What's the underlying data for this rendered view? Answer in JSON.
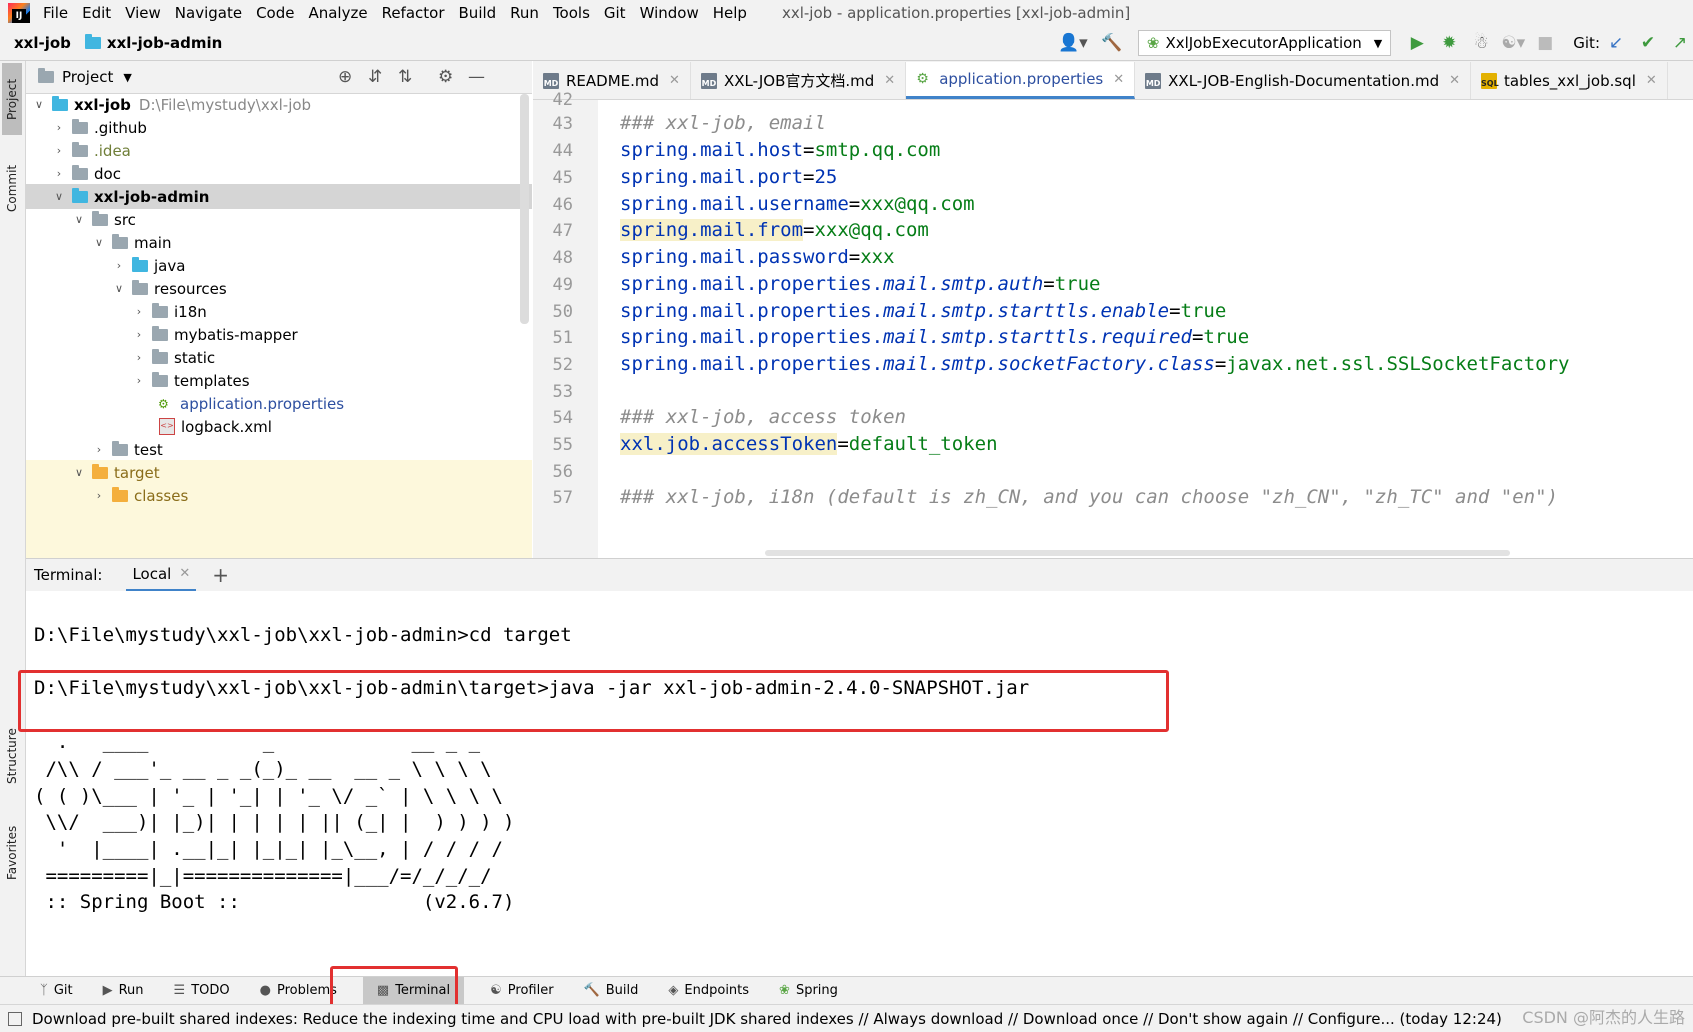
{
  "menubar": {
    "items": [
      "File",
      "Edit",
      "View",
      "Navigate",
      "Code",
      "Analyze",
      "Refactor",
      "Build",
      "Run",
      "Tools",
      "Git",
      "Window",
      "Help"
    ],
    "window_title": "xxl-job - application.properties [xxl-job-admin]"
  },
  "navbar": {
    "crumb_root": "xxl-job",
    "crumb_module": "xxl-job-admin",
    "run_config": "XxlJobExecutorApplication",
    "git_label": "Git:"
  },
  "left_stripe": {
    "project": "Project",
    "commit": "Commit",
    "structure": "Structure",
    "favorites": "Favorites"
  },
  "project_panel": {
    "title": "Project",
    "tree": [
      {
        "label": "xxl-job",
        "hint": "D:\\File\\mystudy\\xxl-job"
      },
      {
        "label": ".github"
      },
      {
        "label": ".idea"
      },
      {
        "label": "doc"
      },
      {
        "label": "xxl-job-admin"
      },
      {
        "label": "src"
      },
      {
        "label": "main"
      },
      {
        "label": "java"
      },
      {
        "label": "resources"
      },
      {
        "label": "i18n"
      },
      {
        "label": "mybatis-mapper"
      },
      {
        "label": "static"
      },
      {
        "label": "templates"
      },
      {
        "label": "application.properties"
      },
      {
        "label": "logback.xml"
      },
      {
        "label": "test"
      },
      {
        "label": "target"
      },
      {
        "label": "classes"
      }
    ]
  },
  "editor": {
    "tabs": [
      "README.md",
      "XXL-JOB官方文档.md",
      "application.properties",
      "XXL-JOB-English-Documentation.md",
      "tables_xxl_job.sql"
    ],
    "line_numbers": [
      "42",
      "43",
      "44",
      "45",
      "46",
      "47",
      "48",
      "49",
      "50",
      "51",
      "52",
      "53",
      "54",
      "55",
      "56",
      "57"
    ],
    "lines": {
      "l43": "### xxl-job, email",
      "l44k": "spring.mail.host",
      "l44v": "smtp.qq.com",
      "l45k": "spring.mail.port",
      "l45v": "25",
      "l46k": "spring.mail.username",
      "l46v": "xxx@qq.com",
      "l47k": "spring.mail.from",
      "l47v": "xxx@qq.com",
      "l48k": "spring.mail.password",
      "l48v": "xxx",
      "l49k": "spring.mail.properties.",
      "l49i": "mail.smtp.auth",
      "l49v": "true",
      "l50k": "spring.mail.properties.",
      "l50i": "mail.smtp.starttls.enable",
      "l50v": "true",
      "l51k": "spring.mail.properties.",
      "l51i": "mail.smtp.starttls.required",
      "l51v": "true",
      "l52k": "spring.mail.properties.",
      "l52i": "mail.smtp.socketFactory.class",
      "l52v": "javax.net.ssl.SSLSocketFactory",
      "l54": "### xxl-job, access token",
      "l55k": "xxl.job.accessToken",
      "l55v": "default_token",
      "l57": "### xxl-job, i18n (default is zh_CN, and you can choose \"zh_CN\", \"zh_TC\" and \"en\")"
    }
  },
  "terminal": {
    "label": "Terminal:",
    "tab": "Local",
    "lines": [
      "D:\\File\\mystudy\\xxl-job\\xxl-job-admin>cd target",
      "D:\\File\\mystudy\\xxl-job\\xxl-job-admin\\target>java -jar xxl-job-admin-2.4.0-SNAPSHOT.jar",
      "  .   ____          _            __ _ _",
      " /\\\\ / ___'_ __ _ _(_)_ __  __ _ \\ \\ \\ \\",
      "( ( )\\___ | '_ | '_| | '_ \\/ _` | \\ \\ \\ \\",
      " \\\\/  ___)| |_)| | | | | || (_| |  ) ) ) )",
      "  '  |____| .__|_| |_|_| |_\\__, | / / / /",
      " =========|_|==============|___/=/_/_/_/",
      " :: Spring Boot ::                (v2.6.7)"
    ]
  },
  "bottom_tabs": [
    "Git",
    "Run",
    "TODO",
    "Problems",
    "Terminal",
    "Profiler",
    "Build",
    "Endpoints",
    "Spring"
  ],
  "status_bar": {
    "message": "Download pre-built shared indexes: Reduce the indexing time and CPU load with pre-built JDK shared indexes // Always download // Download once // Don't show again // Configure... (today 12:24)",
    "watermark": "CSDN @阿杰的人生路"
  },
  "colors": {
    "accent": "#4083c9",
    "highlight_box": "#e23030",
    "key": "#0033b3",
    "value": "#067d17",
    "comment": "#8c8c8c"
  }
}
